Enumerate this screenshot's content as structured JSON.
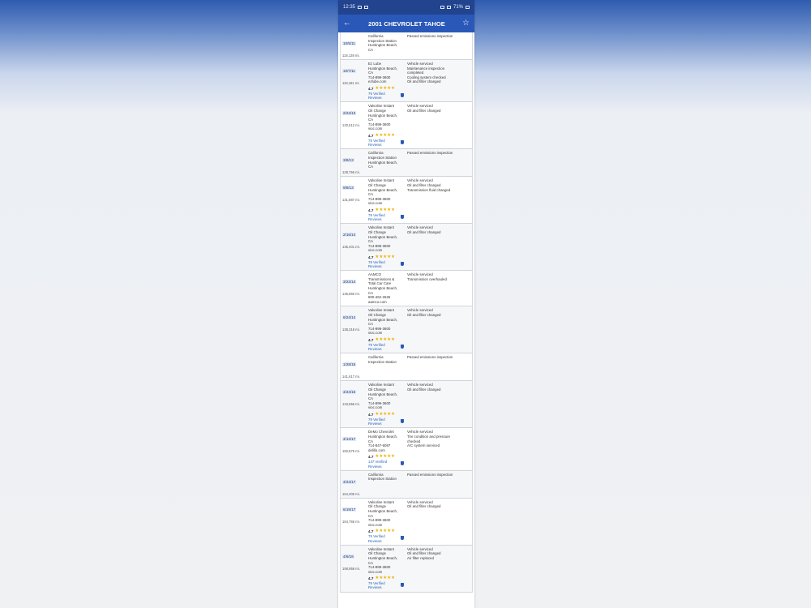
{
  "status": {
    "time": "12:35",
    "battery": "71%"
  },
  "header": {
    "title": "2001 CHEVROLET TAHOE"
  },
  "records": [
    {
      "date": "10/5/11",
      "miles": "118,138 mi.",
      "source": [
        "California",
        "Inspection Station",
        "Huntington Beach,",
        "CA"
      ],
      "details": [
        "Passed emissions inspection"
      ]
    },
    {
      "date": "10/7/11",
      "miles": "118,181 mi.",
      "source": [
        "Ez Lube",
        "Huntington Beach,",
        "CA",
        "714-899-3600",
        "ezlube.com"
      ],
      "details": [
        "Vehicle serviced",
        "Maintenance inspection",
        "completed",
        "Cooling system checked",
        "Oil and filter changed"
      ],
      "rating": "4.7",
      "reviews": [
        "79 Verified",
        "Reviews"
      ]
    },
    {
      "date": "2/24/13",
      "miles": "120,512 mi.",
      "source": [
        "Valvoline Instant",
        "Oil Change",
        "Huntington Beach,",
        "CA",
        "714-899-3600",
        "vioc.com"
      ],
      "details": [
        "Vehicle serviced",
        "Oil and filter changed"
      ],
      "rating": "4.7",
      "reviews": [
        "79 Verified",
        "Reviews"
      ]
    },
    {
      "date": "3/8/13",
      "miles": "128,756 mi.",
      "source": [
        "California",
        "Inspection Station",
        "Huntington Beach,",
        "CA"
      ],
      "details": [
        "Passed emissions inspection"
      ]
    },
    {
      "date": "9/8/13",
      "miles": "131,887 mi.",
      "source": [
        "Valvoline Instant",
        "Oil Change",
        "Huntington Beach,",
        "CA",
        "714-899-3600",
        "vioc.com"
      ],
      "details": [
        "Vehicle serviced",
        "Oil and filter changed",
        "Transmission fluid changed"
      ],
      "rating": "4.7",
      "reviews": [
        "79 Verified",
        "Reviews"
      ]
    },
    {
      "date": "2/16/14",
      "miles": "135,401 mi.",
      "source": [
        "Valvoline Instant",
        "Oil Change",
        "Huntington Beach,",
        "CA",
        "714-899-3600",
        "vioc.com"
      ],
      "details": [
        "Vehicle serviced",
        "Oil and filter changed"
      ],
      "rating": "4.7",
      "reviews": [
        "79 Verified",
        "Reviews"
      ]
    },
    {
      "date": "3/22/14",
      "miles": "135,860 mi.",
      "source": [
        "AAMCO",
        "Transmissions &",
        "Total Car Care",
        "Huntington Beach,",
        "CA",
        "800-462-2626",
        "aamco.com"
      ],
      "details": [
        "Vehicle serviced",
        "Transmission overhauled"
      ]
    },
    {
      "date": "6/24/14",
      "miles": "138,318 mi.",
      "source": [
        "Valvoline Instant",
        "Oil Change",
        "Huntington Beach,",
        "CA",
        "714-899-3600",
        "vioc.com"
      ],
      "details": [
        "Vehicle serviced",
        "Oil and filter changed"
      ],
      "rating": "4.7",
      "reviews": [
        "79 Verified",
        "Reviews"
      ]
    },
    {
      "date": "1/28/15",
      "miles": "141,617 mi.",
      "source": [
        "California",
        "Inspection Station"
      ],
      "details": [
        "Passed emissions inspection"
      ]
    },
    {
      "date": "4/24/15",
      "miles": "143,656 mi.",
      "source": [
        "Valvoline Instant",
        "Oil Change",
        "Huntington Beach,",
        "CA",
        "714-899-3600",
        "vioc.com"
      ],
      "details": [
        "Vehicle serviced",
        "Oil and filter changed"
      ],
      "rating": "4.7",
      "reviews": [
        "79 Verified",
        "Reviews"
      ]
    },
    {
      "date": "4/14/17",
      "miles": "150,875 mi.",
      "source": [
        "DeMo Chevrolet",
        "Huntington Beach,",
        "CA",
        "714-847-6087",
        "delillo.com"
      ],
      "details": [
        "Vehicle serviced",
        "Tire condition and pressure",
        "checked",
        "A/C system serviced"
      ],
      "rating": "4.7",
      "reviews": [
        "147 Verified",
        "Reviews"
      ]
    },
    {
      "date": "4/24/17",
      "miles": "154,308 mi.",
      "source": [
        "California",
        "Inspection Station"
      ],
      "details": [
        "Passed emissions inspection"
      ]
    },
    {
      "date": "6/19/17",
      "miles": "154,765 mi.",
      "source": [
        "Valvoline Instant",
        "Oil Change",
        "Huntington Beach,",
        "CA",
        "714-899-3600",
        "vioc.com"
      ],
      "details": [
        "Vehicle serviced",
        "Oil and filter changed"
      ],
      "rating": "4.7",
      "reviews": [
        "79 Verified",
        "Reviews"
      ]
    },
    {
      "date": "4/6/18",
      "miles": "158,958 mi.",
      "source": [
        "Valvoline Instant",
        "Oil Change",
        "Huntington Beach,",
        "CA",
        "714-899-3600",
        "vioc.com"
      ],
      "details": [
        "Vehicle serviced",
        "Oil and filter changed",
        "Air filter replaced"
      ],
      "rating": "4.7",
      "reviews": [
        "79 Verified",
        "Reviews"
      ]
    }
  ]
}
